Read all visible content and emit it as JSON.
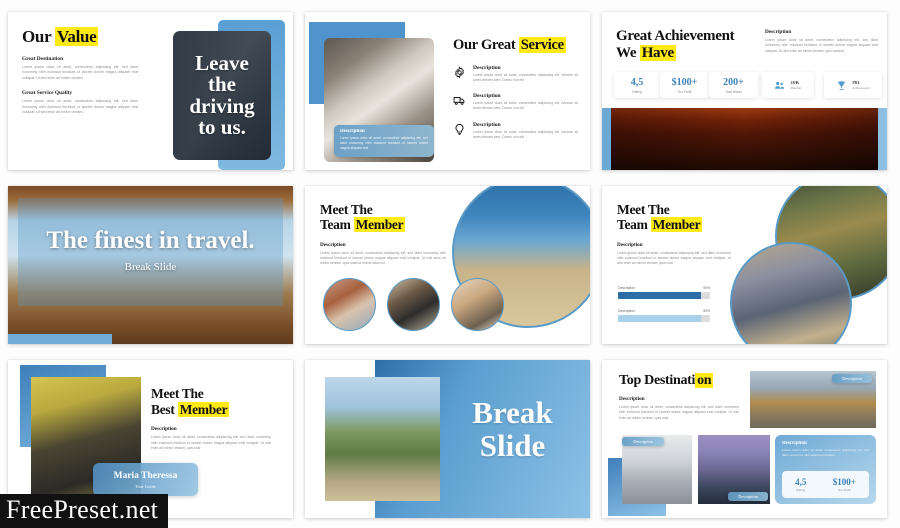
{
  "meta": {
    "watermark": "FreePreset.net",
    "accent_blue": "#3d83b8",
    "accent_light_blue": "#9fcbe6",
    "highlight_yellow": "#ffe916",
    "lorem_short": "Lorem ipsum dolor sit amet, consectetur adipiscing elit. Aenean sit amet ultricies sem. Donec non elit",
    "lorem_long": "Lorem ipsum dolor sit amet, consectetur adipiscing elit, sed diam nonummy nibh euismod tincidunt ut laoreet dolore magna aliquam erat volutpat. Ut wisi enim ad minim veniam, quis nostrud",
    "lorem_mid": "Lorem ipsum dolor sit amet, consectetur adipiscing elit, sed diam nonummy nibh euismod tincidunt ut laoreet dolore magna aliquam erat volutpat. Ut wisi enim ad minim veniam."
  },
  "slides": [
    {
      "id": "our-value",
      "title_plain": "Our ",
      "title_highlight": "Value",
      "sections": [
        {
          "heading": "Great Destination",
          "body": "Lorem ipsum dolor sit amet, consectetur adipiscing elit, sed diam nonummy nibh euismod tincidunt ut laoreet dolore magna aliquam erat volutpat. Ut wisi enim ad minim veniam."
        },
        {
          "heading": "Great Service Quality",
          "body": "Lorem ipsum dolor sit amet, consectetur adipiscing elit, sed diam nonummy nibh euismod tincidunt ut laoreet dolore magna aliquam erat volutpat. Ut wisi enim ad minim veniam."
        }
      ],
      "photo_quote": "Leave the driving to us."
    },
    {
      "id": "our-great-service",
      "title_plain": "Our Great ",
      "title_highlight": "Service",
      "card_heading": "Description",
      "card_body": "Lorem ipsum dolor sit amet, consectetur adipiscing elit, sed diam nonummy nibh euismod tincidunt ut laoreet dolore magna aliquam erat",
      "items": [
        {
          "icon": "gear-icon",
          "heading": "Description",
          "body": "Lorem ipsum dolor sit amet, consectetur adipiscing elit. Aenean sit amet ultricies sem. Donec non elit"
        },
        {
          "icon": "truck-icon",
          "heading": "Description",
          "body": "Lorem ipsum dolor sit amet, consectetur adipiscing elit. Aenean sit amet ultricies sem. Donec non elit"
        },
        {
          "icon": "lightbulb-icon",
          "heading": "Description",
          "body": "Lorem ipsum dolor sit amet, consectetur adipiscing elit. Aenean sit amet ultricies sem. Donec non elit"
        }
      ]
    },
    {
      "id": "great-achievement",
      "title_line1": "Great Achievement",
      "title_line2_plain": "We ",
      "title_line2_highlight": "Have",
      "desc_heading": "Description",
      "desc_body": "Lorem ipsum dolor sit amet, consectetur adipiscing elit, sed diam nonummy nibh euismod tincidunt ut laoreet dolore magna aliquam erat volutpat. Ut wisi enim ad minim veniam, quis nostrud",
      "stats": [
        {
          "value": "4,5",
          "label": "Rating"
        },
        {
          "value": "$100+",
          "label": "Our Profit"
        },
        {
          "value": "200+",
          "label": "Total Works"
        }
      ],
      "icon_stats": [
        {
          "icon": "members-icon",
          "value": "10K",
          "label": "Member"
        },
        {
          "icon": "trophy-icon",
          "value": "#01",
          "label": "Achievement"
        }
      ]
    },
    {
      "id": "break-slide-finest",
      "headline": "The finest in travel.",
      "subhead": "Break Slide"
    },
    {
      "id": "meet-the-team-member-a",
      "title_line1": "Meet The",
      "title_line2_plain": "Team ",
      "title_line2_highlight": "Member",
      "desc_heading": "Description",
      "desc_body": "Lorem ipsum dolor sit amet, consectetur adipiscing elit, sed diam nonummy nibh euismod tincidunt ut laoreet dolore magna aliquam erat volutpat. Ut wisi enim ad minim veniam, quis nostrud exerci tation ull"
    },
    {
      "id": "meet-the-team-member-b",
      "title_line1": "Meet The",
      "title_line2_plain": "Team ",
      "title_line2_highlight": "Member",
      "desc_heading": "Description",
      "desc_body": "Lorem ipsum dolor sit amet, consectetur adipiscing elit, sed diam nonummy nibh euismod tincidunt ut laoreet dolore magna aliquam erat volutpat. Ut wisi enim ad minim veniam, quis nost",
      "bars": [
        {
          "label": "Description",
          "percent_label": "90%",
          "percent": 90,
          "style": "dark"
        },
        {
          "label": "Description",
          "percent_label": "90%",
          "percent": 90,
          "style": "light"
        }
      ]
    },
    {
      "id": "meet-the-best-member",
      "title_line1": "Meet The",
      "title_line2_plain": "Best ",
      "title_line2_highlight": "Member",
      "desc_heading": "Description",
      "desc_body": "Lorem ipsum dolor sit amet, consectetur adipiscing elit, sed diam nonummy nibh euismod tincidunt ut laoreet dolore magna aliquam erat volutpat. Ut wisi enim ad minim veniam, quis nost",
      "person_name": "Maria Theressa",
      "person_role": "Tour Guide"
    },
    {
      "id": "break-slide",
      "headline_line1": "Break",
      "headline_line2": "Slide"
    },
    {
      "id": "top-destination",
      "title_plain": "Top Destinati",
      "title_highlight": "on",
      "desc_heading": "Description",
      "desc_body": "Lorem ipsum dolor sit amet, consectetur adipiscing elit, sed diam nonummy nibh euismod tincidunt ut laoreet dolore magna aliquam erat volutpat. Ut wisi enim ad minim veniam, quis nost",
      "chip_temple": "Description",
      "chip_cathedral": "Description",
      "chip_bridge": "Description",
      "card_heading": "Description",
      "card_body": "Lorem ipsum dolor sit amet, consectetur adipiscing elit, sed diam nonummy nibh euismod tincidunt",
      "stats": [
        {
          "value": "4,5",
          "label": "Rating"
        },
        {
          "value": "$100+",
          "label": "Our Profit"
        }
      ]
    }
  ]
}
